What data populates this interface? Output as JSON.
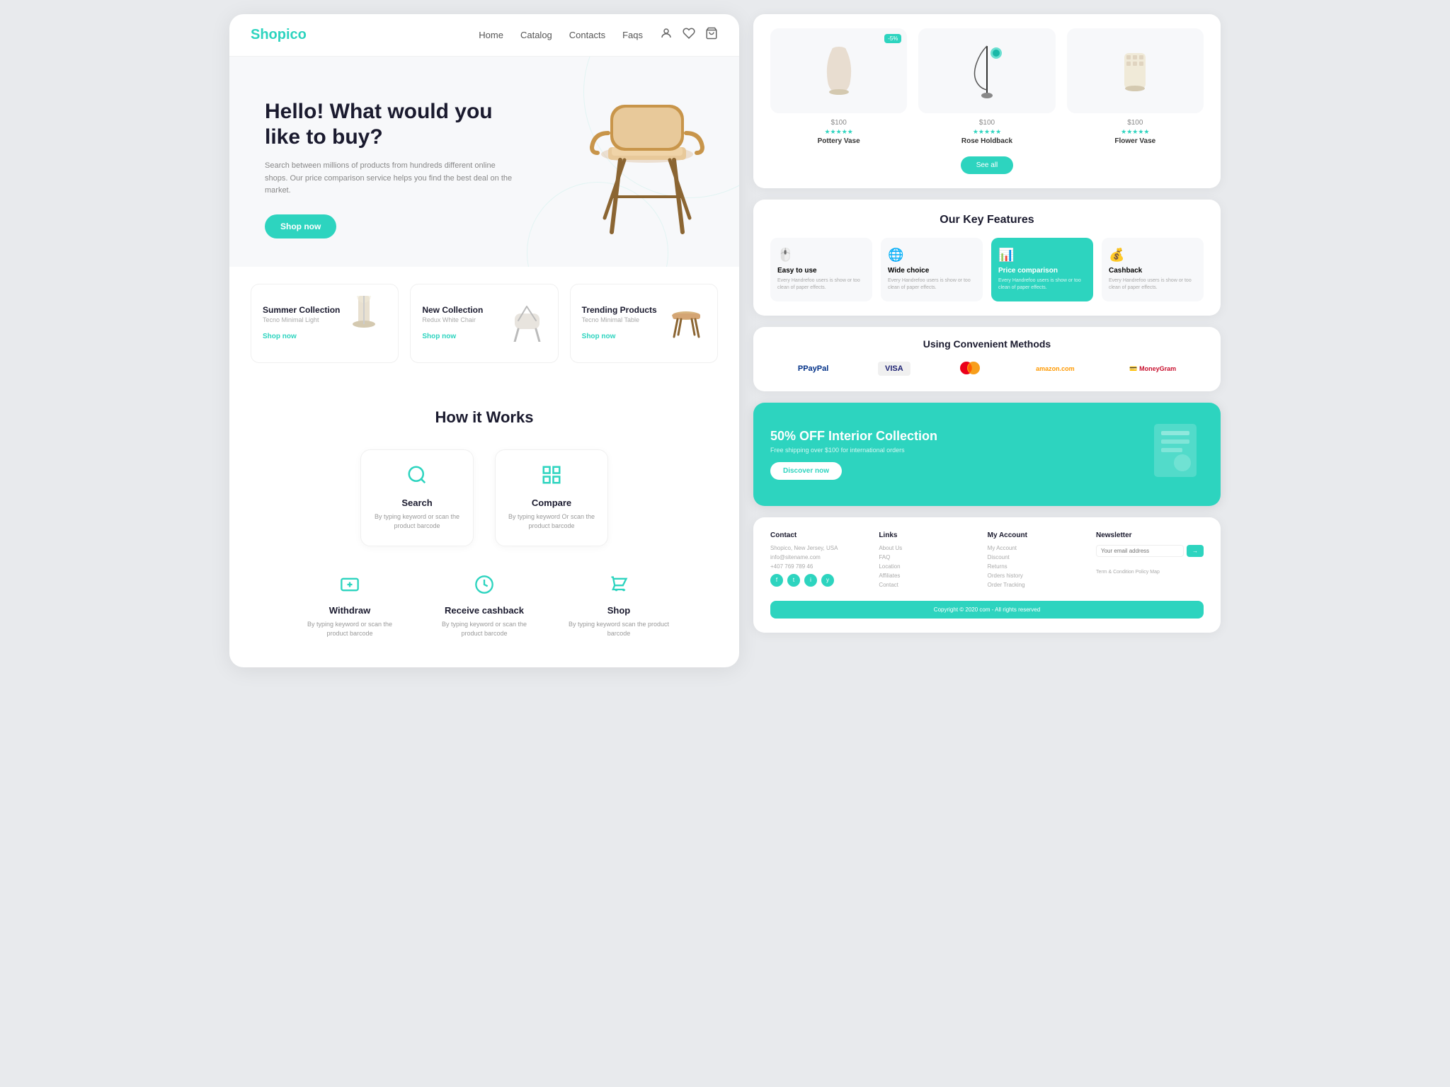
{
  "site": {
    "logo": "Shopico",
    "nav_links": [
      "Home",
      "Catalog",
      "Contacts",
      "Faqs"
    ]
  },
  "hero": {
    "title": "Hello! What would you like to buy?",
    "description": "Search between millions of products from hundreds different online shops. Our price comparison service helps you find the best deal on the market.",
    "cta_label": "Shop now"
  },
  "product_cards": [
    {
      "collection": "Summer Collection",
      "name": "Tecno Minimal Light",
      "shop_label": "Shop now"
    },
    {
      "collection": "New Collection",
      "name": "Redux White Chair",
      "shop_label": "Shop now"
    },
    {
      "collection": "Trending Products",
      "name": "Tecno Minimal Table",
      "shop_label": "Shop now"
    }
  ],
  "how_it_works": {
    "title": "How it Works",
    "steps": [
      {
        "id": "search",
        "label": "Search",
        "description": "By typing keyword or scan the product barcode"
      },
      {
        "id": "compare",
        "label": "Compare",
        "description": "By typing keyword Or scan the product barcode"
      }
    ],
    "steps2": [
      {
        "id": "withdraw",
        "label": "Withdraw",
        "description": "By typing keyword or scan the product barcode"
      },
      {
        "id": "cashback",
        "label": "Receive cashback",
        "description": "By typing keyword or scan the product barcode"
      },
      {
        "id": "shop",
        "label": "Shop",
        "description": "By typing keyword scan the product barcode"
      }
    ]
  },
  "products_right": {
    "items": [
      {
        "name": "Pottery Vase",
        "price": "$100",
        "stars": "★★★★★"
      },
      {
        "name": "Rose Holdback",
        "price": "$100",
        "stars": "★★★★★"
      },
      {
        "name": "Flower Vase",
        "price": "$100",
        "stars": "★★★★★"
      }
    ],
    "see_all_label": "See all"
  },
  "key_features": {
    "title": "Our Key Features",
    "features": [
      {
        "icon": "🖱️",
        "label": "Easy to use",
        "description": "Every Handrefoo users is show or too clean of paper effects.",
        "active": false
      },
      {
        "icon": "🌐",
        "label": "Wide choice",
        "description": "Every Handrefoo users is show or too clean of paper effects.",
        "active": false
      },
      {
        "icon": "📊",
        "label": "Price comparison",
        "description": "Every Handrefoo users is show or too clean of paper effects.",
        "active": true
      },
      {
        "icon": "💰",
        "label": "Cashback",
        "description": "Every Handrefoo users is show or too clean of paper effects.",
        "active": false
      }
    ]
  },
  "payment": {
    "title": "Using Convenient Methods",
    "methods": [
      "PayPal",
      "VISA",
      "Mastercard",
      "amazon.com",
      "MoneyGram"
    ]
  },
  "promo": {
    "badge": "50% OFF Interior Collection",
    "description": "Free shipping over $100 for international orders",
    "cta_label": "Discover now"
  },
  "footer": {
    "columns": [
      {
        "title": "Contact",
        "items": [
          "Shopico, New Jersey, USA",
          "info@sitename.com",
          "+407 769 789 46"
        ]
      },
      {
        "title": "Links",
        "items": [
          "About Us",
          "FAQ",
          "Location",
          "Affiliates",
          "Contact"
        ]
      },
      {
        "title": "My Account",
        "items": [
          "My Account",
          "Discount",
          "Returns",
          "Orders history",
          "Order Tracking"
        ]
      },
      {
        "title": "Newsletter",
        "placeholder": "Your email address"
      }
    ],
    "copyright": "Copyright © 2020 com - All rights reserved",
    "terms": "Term & Condition   Policy   Map"
  }
}
